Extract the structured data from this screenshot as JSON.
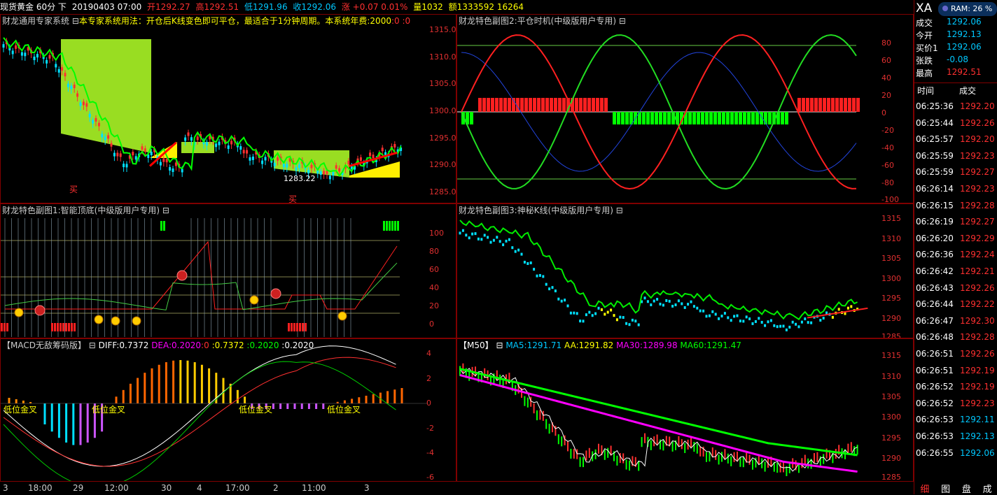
{
  "topbar": {
    "instrument": "现货黄金 60分 下",
    "date": "20190403 07:00",
    "open": "开1292.27",
    "high": "高1292.51",
    "low": "低1291.96",
    "close": "收1292.06",
    "change": "涨 +0.07 0.01%",
    "volume": "量1032",
    "amount": "额1333592 16264"
  },
  "main_panel": {
    "title": "财龙通用专家系统 ⊟",
    "usage": "本专家系统用法：开仓后K线变色即可平仓，最适合于1分钟周期。本系统年费:2000",
    "extra": ":0 :0",
    "buy_label_1": "买",
    "buy_label_2": "买",
    "low_label": "1283.22",
    "y_ticks": [
      "1315.0",
      "1310.0",
      "1305.0",
      "1300.0",
      "1295.0",
      "1290.0",
      "1285.0"
    ]
  },
  "sub1": {
    "title": "财龙特色副图1:智能顶底(中级版用户专用) ⊟",
    "y_ticks": [
      "100",
      "80",
      "60",
      "40",
      "20",
      "0"
    ]
  },
  "macd": {
    "title": "【MACD无敌筹码版】 ⊟",
    "diff": "DIFF:0.7372",
    "dea": "DEA:0.2020",
    "z": ":0",
    "v1": ":0.7372",
    "v2": ":0.2020",
    "v3": ":0.2020",
    "cross_label": "低位金叉",
    "y_ticks": [
      "4",
      "2",
      "0",
      "-2",
      "-4",
      "-6"
    ]
  },
  "sub2": {
    "title": "财龙特色副图2:平仓时机(中级版用户专用) ⊟",
    "y_ticks": [
      "80",
      "60",
      "40",
      "20",
      "0",
      "-20",
      "-40",
      "-60",
      "-80",
      "-100"
    ]
  },
  "sub3": {
    "title": "财龙特色副图3:神秘K线(中级版用户专用) ⊟",
    "y_ticks": [
      "1315",
      "1310",
      "1305",
      "1300",
      "1295",
      "1290",
      "1285"
    ]
  },
  "m50": {
    "title": "【M50】 ⊟",
    "ma5": "MA5:1291.71",
    "aa": "AA:1291.82",
    "ma30": "MA30:1289.98",
    "ma60": "MA60:1291.47",
    "y_ticks": [
      "1315",
      "1310",
      "1305",
      "1300",
      "1295",
      "1290",
      "1285"
    ]
  },
  "time_axis": [
    "3",
    "18:00",
    "29",
    "12:00",
    "30",
    "4",
    "17:00",
    "2",
    "11:00",
    "3"
  ],
  "right_panel": {
    "symbol": "XA",
    "ram": "RAM: 26 %",
    "quotes": [
      {
        "label": "成交",
        "value": "1292.06",
        "color": "#00c8ff"
      },
      {
        "label": "今开",
        "value": "1292.13",
        "color": "#00c8ff"
      },
      {
        "label": "买价1",
        "value": "1292.06",
        "color": "#00c8ff"
      },
      {
        "label": "张跌",
        "value": "-0.08",
        "color": "#00c8ff"
      },
      {
        "label": "最高",
        "value": "1292.51",
        "color": "#ff3030"
      }
    ],
    "tick_header_time": "时间",
    "tick_header_price": "成交",
    "ticks": [
      {
        "time": "06:25:36",
        "price": "1292.20",
        "color": "#ff3030"
      },
      {
        "time": "06:25:44",
        "price": "1292.26",
        "color": "#ff3030"
      },
      {
        "time": "06:25:57",
        "price": "1292.20",
        "color": "#ff3030"
      },
      {
        "time": "06:25:59",
        "price": "1292.23",
        "color": "#ff3030"
      },
      {
        "time": "06:25:59",
        "price": "1292.27",
        "color": "#ff3030"
      },
      {
        "time": "06:26:14",
        "price": "1292.23",
        "color": "#ff3030"
      },
      {
        "time": "06:26:15",
        "price": "1292.28",
        "color": "#ff3030"
      },
      {
        "time": "06:26:19",
        "price": "1292.27",
        "color": "#ff3030"
      },
      {
        "time": "06:26:20",
        "price": "1292.29",
        "color": "#ff3030"
      },
      {
        "time": "06:26:36",
        "price": "1292.24",
        "color": "#ff3030"
      },
      {
        "time": "06:26:42",
        "price": "1292.21",
        "color": "#ff3030"
      },
      {
        "time": "06:26:43",
        "price": "1292.26",
        "color": "#ff3030"
      },
      {
        "time": "06:26:44",
        "price": "1292.22",
        "color": "#ff3030"
      },
      {
        "time": "06:26:47",
        "price": "1292.30",
        "color": "#ff3030"
      },
      {
        "time": "06:26:48",
        "price": "1292.28",
        "color": "#ff3030"
      },
      {
        "time": "06:26:51",
        "price": "1292.26",
        "color": "#ff3030"
      },
      {
        "time": "06:26:51",
        "price": "1292.19",
        "color": "#ff3030"
      },
      {
        "time": "06:26:52",
        "price": "1292.19",
        "color": "#ff3030"
      },
      {
        "time": "06:26:52",
        "price": "1292.23",
        "color": "#ff3030"
      },
      {
        "time": "06:26:53",
        "price": "1292.11",
        "color": "#00c8ff"
      },
      {
        "time": "06:26:53",
        "price": "1292.13",
        "color": "#00c8ff"
      },
      {
        "time": "06:26:55",
        "price": "1292.06",
        "color": "#00c8ff"
      }
    ],
    "tabs": [
      "细",
      "图",
      "盘",
      "成"
    ]
  }
}
